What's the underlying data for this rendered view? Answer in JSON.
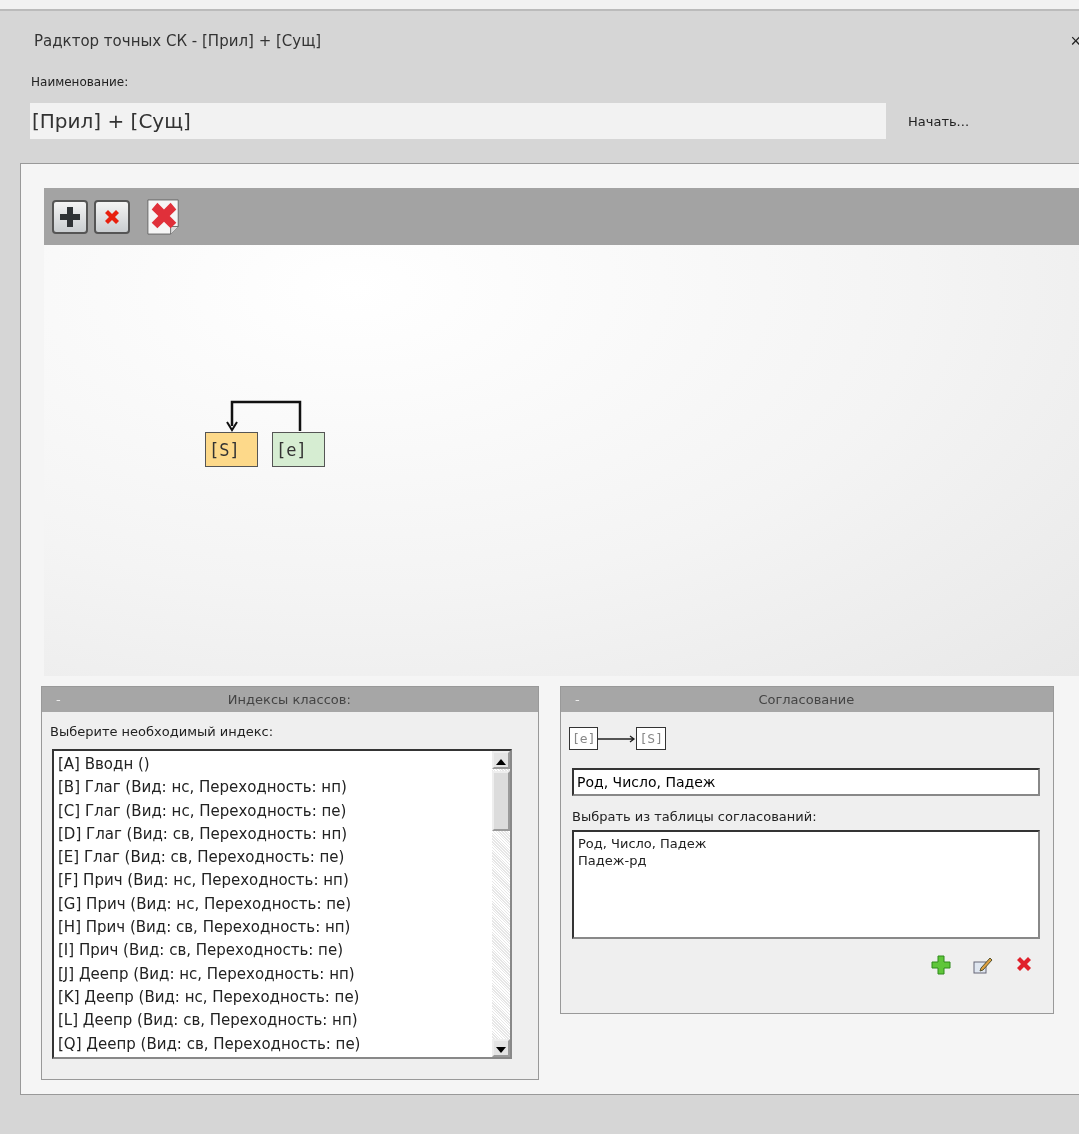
{
  "window": {
    "title": "Радктор точных СК - [Прил] + [Сущ]",
    "close": "×"
  },
  "name_label": "Наименование:",
  "name_value": "[Прил] + [Сущ]",
  "start_button": "Начать...",
  "diagram": {
    "nodes": [
      {
        "label": "[S]",
        "color": "#fdd98a"
      },
      {
        "label": "[e]",
        "color": "#d6edd2"
      }
    ]
  },
  "class_indexes": {
    "collapse": "-",
    "title": "Индексы классов:",
    "prompt": "Выберите необходимый индекс:",
    "items": [
      "[A] Вводн ()",
      "[B] Глаг (Вид: нс, Переходность: нп)",
      "[C] Глаг (Вид: нс, Переходность: пе)",
      "[D] Глаг (Вид: св, Переходность: нп)",
      "[E] Глаг (Вид: св, Переходность: пе)",
      "[F] Прич (Вид: нс, Переходность: нп)",
      "[G] Прич (Вид: нс, Переходность: пе)",
      "[H] Прич (Вид: св, Переходность: нп)",
      "[I] Прич (Вид: св, Переходность: пе)",
      "[J] Деепр (Вид: нс, Переходность: нп)",
      "[K] Деепр (Вид: нс, Переходность: пе)",
      "[L] Деепр (Вид: св, Переходность: нп)",
      "[Q] Деепр (Вид: св, Переходность: пе)"
    ]
  },
  "agreement": {
    "collapse": "-",
    "title": "Согласование",
    "from": "[e]",
    "to": "[S]",
    "value": "Род, Число, Падеж",
    "table_label": "Выбрать из таблицы согласований:",
    "options": [
      "Род, Число, Падеж",
      "Падеж-рд"
    ]
  }
}
